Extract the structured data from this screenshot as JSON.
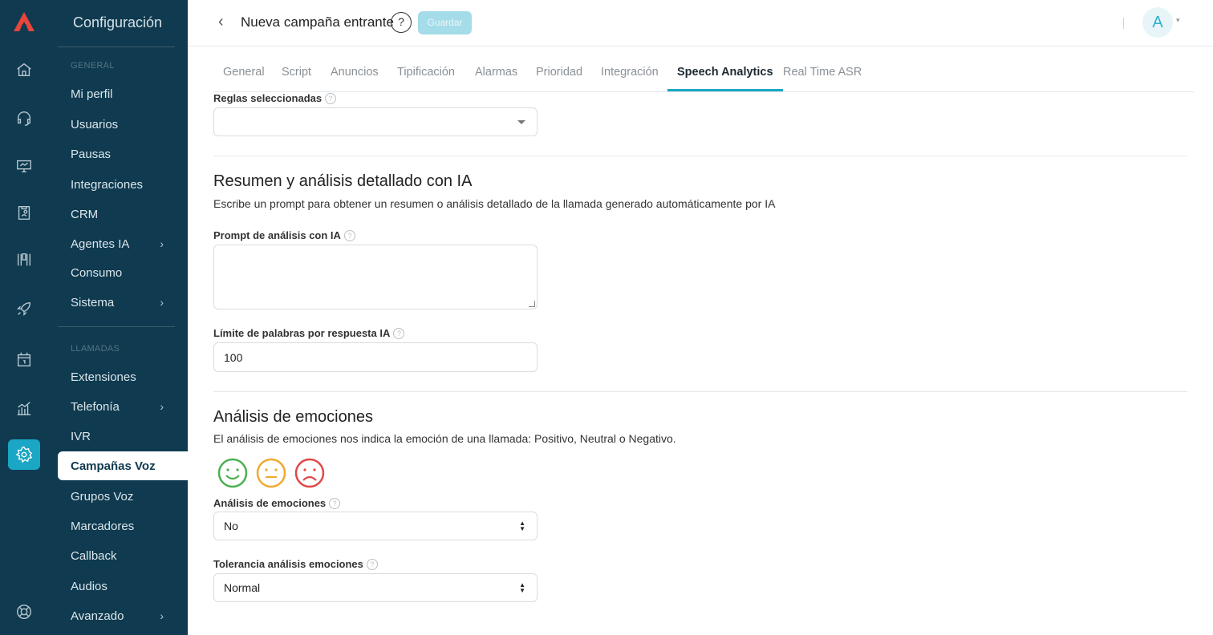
{
  "app": {
    "section_title": "Configuración"
  },
  "rail": {
    "items": [
      "home-icon",
      "headset-icon",
      "monitor-icon",
      "badge-icon",
      "columns-icon",
      "rocket-icon",
      "calendar-icon",
      "chart-icon",
      "gear-icon",
      "lifebuoy-icon"
    ]
  },
  "sidebar": {
    "general_header": "GENERAL",
    "calls_header": "LLAMADAS",
    "items": [
      {
        "label": "Mi perfil"
      },
      {
        "label": "Usuarios"
      },
      {
        "label": "Pausas"
      },
      {
        "label": "Integraciones"
      },
      {
        "label": "CRM"
      },
      {
        "label": "Agentes IA",
        "chevron": "›"
      },
      {
        "label": "Consumo"
      },
      {
        "label": "Sistema",
        "chevron": "›"
      },
      {
        "label": "Extensiones"
      },
      {
        "label": "Telefonía",
        "chevron": "›"
      },
      {
        "label": "IVR"
      },
      {
        "label": "Campañas Voz"
      },
      {
        "label": "Grupos Voz"
      },
      {
        "label": "Marcadores"
      },
      {
        "label": "Callback"
      },
      {
        "label": "Audios"
      },
      {
        "label": "Avanzado",
        "chevron": "›"
      }
    ]
  },
  "header": {
    "back_glyph": "‹",
    "title": "Nueva campaña entrante",
    "help_glyph": "?",
    "save_label": "Guardar",
    "avatar_letter": "A",
    "avatar_caret": "▾"
  },
  "tabs": [
    "General",
    "Script",
    "Anuncios",
    "Tipificación",
    "Alarmas",
    "Prioridad",
    "Integración",
    "Speech Analytics",
    "Real Time ASR"
  ],
  "tabs_active": "Speech Analytics",
  "form": {
    "rules_label": "Reglas seleccionadas",
    "rules_value": "",
    "ai_title": "Resumen y análisis detallado con IA",
    "ai_desc": "Escribe un prompt para obtener un resumen o análisis detallado de la llamada generado automáticamente por IA",
    "prompt_label": "Prompt de análisis con IA",
    "prompt_value": "",
    "word_limit_label": "Límite de palabras por respuesta IA",
    "word_limit_value": "100",
    "emotions_title": "Análisis de emociones",
    "emotions_desc": "El análisis de emociones nos indica la emoción de una llamada: Positivo, Neutral o Negativo.",
    "emotion_colors": {
      "positive": "#4caf50",
      "neutral": "#f0a92e",
      "negative": "#e04848"
    },
    "emotions_label": "Análisis de emociones",
    "emotions_value": "No",
    "tolerance_label": "Tolerancia análisis emociones",
    "tolerance_value": "Normal",
    "help_glyph": "?"
  }
}
